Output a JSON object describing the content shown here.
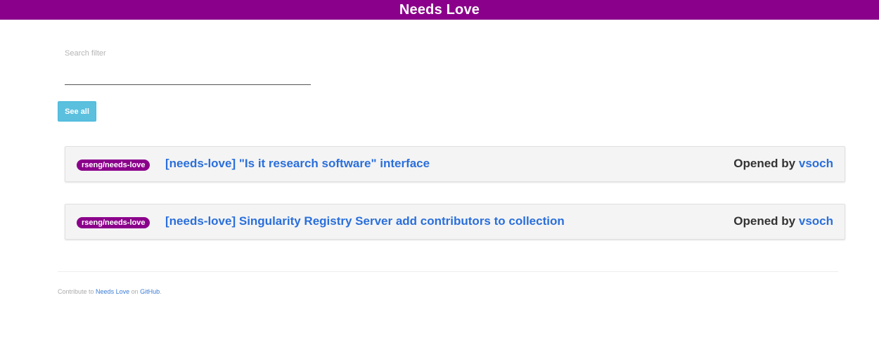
{
  "header": {
    "title": "Needs Love"
  },
  "filter": {
    "label": "Search filter",
    "value": ""
  },
  "controls": {
    "see_all_label": "See all"
  },
  "issues": [
    {
      "repo": "rseng/needs-love",
      "title": "[needs-love] \"Is it research software\" interface",
      "opened_by_label": "Opened by",
      "author": "vsoch"
    },
    {
      "repo": "rseng/needs-love",
      "title": "[needs-love] Singularity Registry Server add contributors to collection",
      "opened_by_label": "Opened by",
      "author": "vsoch"
    }
  ],
  "footer": {
    "prefix": "Contribute to",
    "project_link": "Needs Love",
    "middle": "on",
    "host_link": "GitHub",
    "suffix": "."
  },
  "colors": {
    "brand": "#8b008b",
    "accent_button": "#5bc0de",
    "link": "#2a6fdb"
  }
}
